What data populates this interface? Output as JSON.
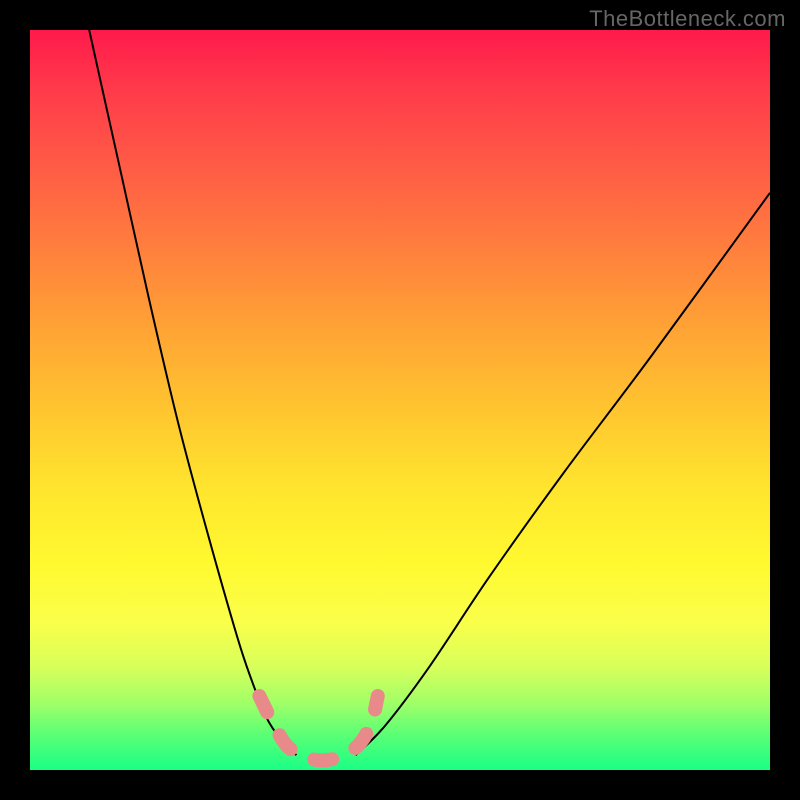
{
  "watermark": "TheBottleneck.com",
  "chart_data": {
    "type": "line",
    "title": "",
    "xlabel": "",
    "ylabel": "",
    "xlim": [
      0,
      100
    ],
    "ylim": [
      0,
      100
    ],
    "grid": false,
    "legend": false,
    "description": "Bottleneck curve. Vertical position = bottleneck %. Color gradient red (top, 100%) → green (bottom, 0%). Two black curves descend from top; thick pink dashed segment marks the optimal valley near the bottom.",
    "gradient_stops": [
      {
        "pct": 0,
        "color": "#ff1a4b",
        "meaning": 100
      },
      {
        "pct": 50,
        "color": "#ffc72f",
        "meaning": 50
      },
      {
        "pct": 80,
        "color": "#faff4a",
        "meaning": 20
      },
      {
        "pct": 100,
        "color": "#1aff85",
        "meaning": 0
      }
    ],
    "series": [
      {
        "name": "left-curve",
        "x": [
          8,
          12,
          16,
          20,
          24,
          28,
          30,
          32,
          34,
          36
        ],
        "y": [
          100,
          82,
          64,
          47,
          32,
          18,
          12,
          7,
          4,
          2
        ]
      },
      {
        "name": "right-curve",
        "x": [
          44,
          48,
          54,
          62,
          72,
          84,
          100
        ],
        "y": [
          2,
          6,
          14,
          26,
          40,
          56,
          78
        ]
      },
      {
        "name": "optimal-zone-dashed",
        "x": [
          31,
          33,
          35,
          38,
          41,
          44,
          46,
          47
        ],
        "y": [
          10,
          6,
          3,
          1.5,
          1.5,
          3,
          6,
          10
        ]
      }
    ]
  }
}
